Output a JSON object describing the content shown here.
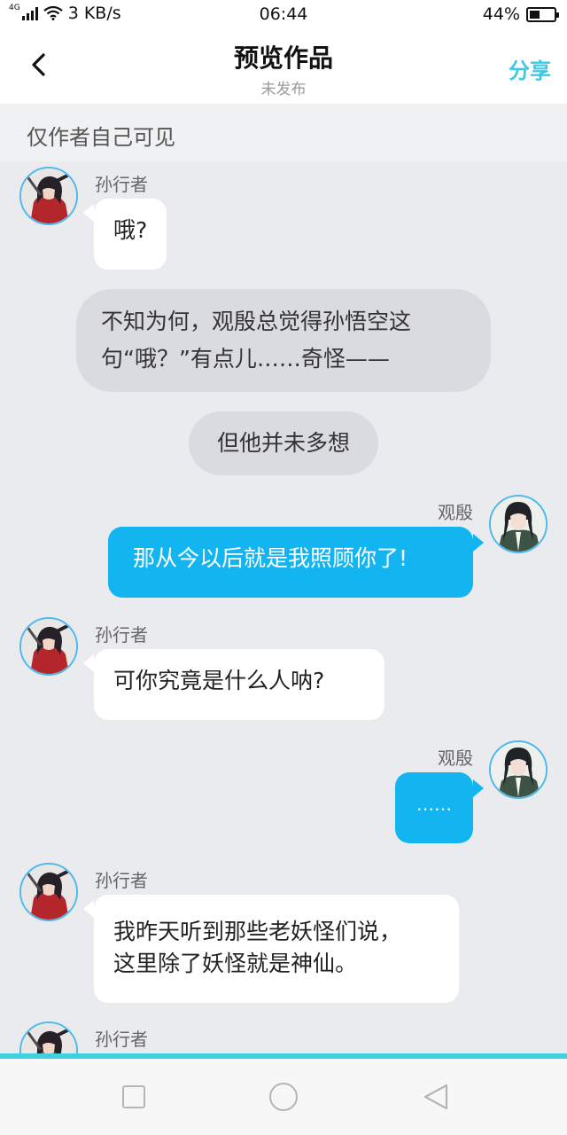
{
  "status_bar": {
    "network": "4G",
    "speed": "3 KB/s",
    "time": "06:44",
    "battery_percent": "44%",
    "battery_level": 0.44
  },
  "header": {
    "title": "预览作品",
    "subtitle": "未发布",
    "share_label": "分享"
  },
  "notice": "仅作者自己可见",
  "messages": [
    {
      "type": "left",
      "name": "孙行者",
      "text": "哦?"
    },
    {
      "type": "narration",
      "lines": [
        "不知为何，观殷总觉得孙悟空这",
        "句“哦？”有点儿……奇怪——"
      ]
    },
    {
      "type": "narration",
      "lines": [
        "但他并未多想"
      ]
    },
    {
      "type": "right",
      "name": "观殷",
      "text": "那从今以后就是我照顾你了!"
    },
    {
      "type": "left",
      "name": "孙行者",
      "text": "可你究竟是什么人呐?"
    },
    {
      "type": "right",
      "name": "观殷",
      "text": "……"
    },
    {
      "type": "left",
      "name": "孙行者",
      "lines": [
        "我昨天听到那些老妖怪们说，",
        "这里除了妖怪就是神仙。"
      ]
    },
    {
      "type": "left",
      "name": "孙行者"
    }
  ],
  "colors": {
    "accent": "#3ec9e6",
    "right_bubble": "#13b5f0",
    "background": "#eaebef"
  },
  "icons": {
    "back": "chevron-left-icon",
    "nav_recent": "square-icon",
    "nav_home": "circle-icon",
    "nav_back": "triangle-back-icon"
  }
}
